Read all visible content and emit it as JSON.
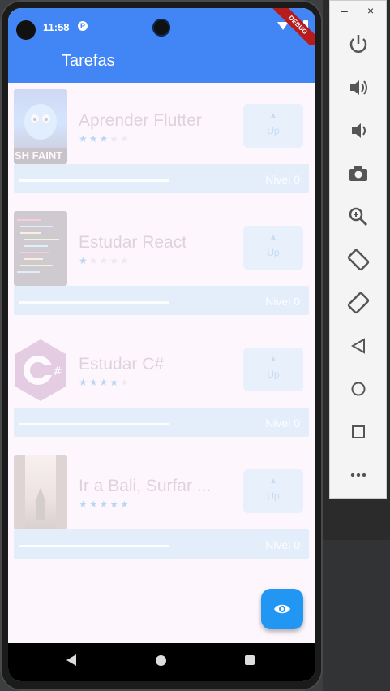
{
  "status_bar": {
    "time": "11:58",
    "debug_banner": "DEBUG"
  },
  "app_bar": {
    "title": "Tarefas"
  },
  "tasks": [
    {
      "name": "Aprender Flutter",
      "difficulty": 3,
      "max_difficulty": 5,
      "up_label": "Up",
      "level_label": "Nivel 0",
      "progress": 0
    },
    {
      "name": "Estudar React",
      "difficulty": 1,
      "max_difficulty": 5,
      "up_label": "Up",
      "level_label": "Nivel 0",
      "progress": 0
    },
    {
      "name": "Estudar C#",
      "difficulty": 4,
      "max_difficulty": 5,
      "up_label": "Up",
      "level_label": "Nivel 0",
      "progress": 0
    },
    {
      "name": "Ir a Bali, Surfar ...",
      "difficulty": 5,
      "max_difficulty": 5,
      "up_label": "Up",
      "level_label": "Nivel 0",
      "progress": 0
    }
  ],
  "thumbnail_texts": {
    "task0": "SH FAINT"
  },
  "fab": {
    "icon": "eye-icon"
  },
  "emulator_panel": {
    "window_controls": [
      "–",
      "×"
    ],
    "buttons": [
      "power-icon",
      "volume-up-icon",
      "volume-down-icon",
      "camera-icon",
      "zoom-icon",
      "rotate-left-icon",
      "rotate-right-icon",
      "back-icon",
      "home-icon",
      "overview-icon",
      "more-icon"
    ]
  },
  "colors": {
    "app_bar": "#4285f4",
    "fab": "#2196f3",
    "card_bg": "#fdf7fd",
    "bar_bg": "#e4eefb"
  }
}
